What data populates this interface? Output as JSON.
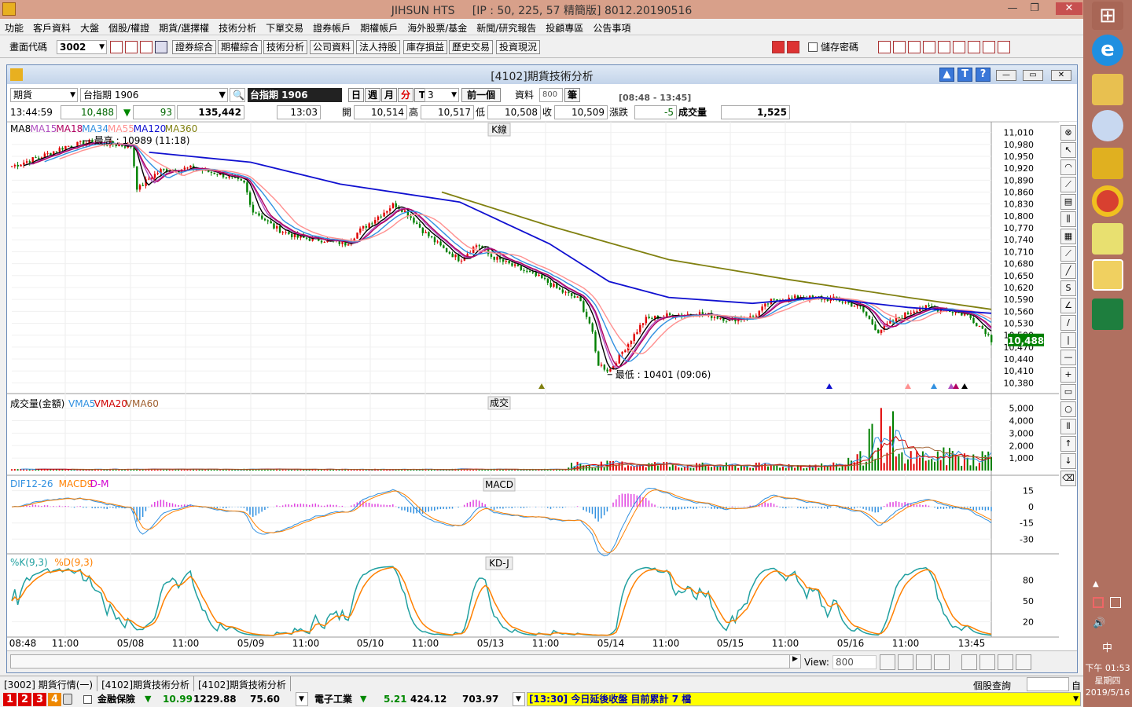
{
  "app": {
    "title": "JIHSUN HTS",
    "conn": "[IP : 50, 225, 57 精簡版] 8012.20190516"
  },
  "menu": [
    "功能",
    "客戶資料",
    "大盤",
    "個股/權證",
    "期貨/選擇權",
    "技術分析",
    "下單交易",
    "證券帳戶",
    "期權帳戶",
    "海外股票/基金",
    "新聞/研究報告",
    "投顧專區",
    "公告事項"
  ],
  "toolbar": {
    "code_label": "畫面代碼",
    "code_value": "3002",
    "buttons": [
      "證券綜合",
      "期權綜合",
      "技術分析",
      "公司資料",
      "法人持股",
      "庫存損益",
      "歷史交易",
      "投資現況"
    ],
    "save_pw": "儲存密碼"
  },
  "window": {
    "title": "[4102]期貨技術分析"
  },
  "query": {
    "type": "期貨",
    "symbol": "台指期 1906",
    "symbol_dark": "台指期 1906",
    "periods": [
      "日",
      "週",
      "月",
      "分",
      "T"
    ],
    "minutes": "3",
    "prev": "前一個",
    "data_label": "資料",
    "data_count": "800",
    "unit": "筆",
    "session": "[08:48 - 13:45]"
  },
  "quote": {
    "time": "13:44:59",
    "price": "10,488",
    "change": "93",
    "total": "135,442",
    "bar_time": "13:03",
    "open_label": "開",
    "open": "10,514",
    "high_label": "高",
    "high": "10,517",
    "low_label": "低",
    "low": "10,508",
    "close_label": "收",
    "close": "10,509",
    "chg_label": "漲跌",
    "chg": "-5",
    "vol_label": "成交量",
    "vol": "1,525"
  },
  "chart_data": [
    {
      "type": "candlestick",
      "panel": "K線",
      "legend": [
        {
          "name": "MA8",
          "color": "#000000"
        },
        {
          "name": "MA15",
          "color": "#b050c0"
        },
        {
          "name": "MA18",
          "color": "#b00060"
        },
        {
          "name": "MA34",
          "color": "#3090e0"
        },
        {
          "name": "MA55",
          "color": "#ff9090"
        },
        {
          "name": "MA120",
          "color": "#1010d0"
        },
        {
          "name": "MA360",
          "color": "#808010"
        }
      ],
      "y_ticks": [
        11010,
        10980,
        10950,
        10920,
        10890,
        10860,
        10830,
        10800,
        10770,
        10740,
        10710,
        10680,
        10650,
        10620,
        10590,
        10560,
        10530,
        10500,
        10470,
        10440,
        10410,
        10380
      ],
      "ylim": [
        10365,
        11025
      ],
      "high_note": "最高 : 10989 (11:18)",
      "low_note": "最低 : 10401 (09:06)",
      "last": "10,488",
      "path_points": [
        [
          0,
          10925
        ],
        [
          5,
          10950
        ],
        [
          9,
          10975
        ],
        [
          13,
          10985
        ],
        [
          17,
          10980
        ],
        [
          20,
          10975
        ],
        [
          21,
          10865
        ],
        [
          23,
          10895
        ],
        [
          25,
          10915
        ],
        [
          30,
          10920
        ],
        [
          35,
          10905
        ],
        [
          39,
          10880
        ],
        [
          40,
          10820
        ],
        [
          44,
          10770
        ],
        [
          48,
          10745
        ],
        [
          52,
          10740
        ],
        [
          56,
          10730
        ],
        [
          58,
          10760
        ],
        [
          61,
          10795
        ],
        [
          64,
          10830
        ],
        [
          66,
          10810
        ],
        [
          69,
          10760
        ],
        [
          72,
          10720
        ],
        [
          75,
          10690
        ],
        [
          78,
          10730
        ],
        [
          80,
          10700
        ],
        [
          83,
          10680
        ],
        [
          86,
          10660
        ],
        [
          89,
          10640
        ],
        [
          92,
          10610
        ],
        [
          95,
          10590
        ],
        [
          97,
          10520
        ],
        [
          98,
          10430
        ],
        [
          100,
          10410
        ],
        [
          103,
          10475
        ],
        [
          106,
          10540
        ],
        [
          110,
          10550
        ],
        [
          115,
          10555
        ],
        [
          120,
          10540
        ],
        [
          124,
          10545
        ],
        [
          127,
          10585
        ],
        [
          132,
          10595
        ],
        [
          138,
          10590
        ],
        [
          142,
          10570
        ],
        [
          145,
          10510
        ],
        [
          148,
          10540
        ],
        [
          152,
          10570
        ],
        [
          156,
          10565
        ],
        [
          160,
          10550
        ],
        [
          163,
          10510
        ],
        [
          164,
          10488
        ]
      ],
      "ma120": [
        [
          23,
          10960
        ],
        [
          40,
          10935
        ],
        [
          55,
          10880
        ],
        [
          75,
          10835
        ],
        [
          90,
          10730
        ],
        [
          100,
          10635
        ],
        [
          110,
          10595
        ],
        [
          124,
          10580
        ],
        [
          135,
          10595
        ],
        [
          150,
          10570
        ],
        [
          164,
          10555
        ]
      ],
      "ma360": [
        [
          72,
          10860
        ],
        [
          90,
          10775
        ],
        [
          110,
          10690
        ],
        [
          130,
          10640
        ],
        [
          150,
          10595
        ],
        [
          164,
          10565
        ]
      ]
    },
    {
      "type": "bar",
      "panel": "成交",
      "legend": [
        {
          "name": "成交量(金額)",
          "color": "#000000"
        },
        {
          "name": "VMA5",
          "color": "#3090e0"
        },
        {
          "name": "VMA20",
          "color": "#d00000"
        },
        {
          "name": "VMA60",
          "color": "#a06030"
        }
      ],
      "y_ticks": [
        5000,
        4000,
        3000,
        2000,
        1000
      ],
      "ylim": [
        0,
        5800
      ]
    },
    {
      "type": "line",
      "panel": "MACD",
      "legend": [
        {
          "name": "DIF12-26",
          "color": "#3090e0"
        },
        {
          "name": "MACD9",
          "color": "#ff8000"
        },
        {
          "name": "D-M",
          "color": "#d000d0"
        }
      ],
      "y_ticks": [
        15,
        0,
        -15,
        -30
      ],
      "ylim": [
        -40,
        22
      ]
    },
    {
      "type": "line",
      "panel": "KD-J",
      "legend": [
        {
          "name": "%K(9,3)",
          "color": "#20a0a0"
        },
        {
          "name": "%D(9,3)",
          "color": "#ff8000"
        }
      ],
      "y_ticks": [
        80,
        50,
        20
      ],
      "ylim": [
        0,
        100
      ]
    }
  ],
  "x_ticks": [
    "08:48",
    "11:00",
    "05/08",
    "11:00",
    "05/09",
    "11:00",
    "05/10",
    "11:00",
    "05/13",
    "11:00",
    "05/14",
    "11:00",
    "05/15",
    "11:00",
    "05/16",
    "11:00",
    "13:45"
  ],
  "bottom": {
    "view_label": "View:",
    "view_value": "800"
  },
  "tabs": [
    "[3002] 期貨行情(一)",
    "[4102]期貨技術分析",
    "[4102]期貨技術分析"
  ],
  "tabs_right": "個股查詢",
  "tabs_right2": "自",
  "status": {
    "nums": [
      "1",
      "2",
      "3",
      "4"
    ],
    "s1_name": "金融保險",
    "s1_chg": "10.99",
    "s1_val": "1229.88",
    "s1_amt": "75.60",
    "s2_name": "電子工業",
    "s2_chg": "5.21",
    "s2_val": "424.12",
    "s2_amt": "703.97",
    "ticker": "[13:30] 今日延後收盤 目前累計 7 檔"
  },
  "taskbar": {
    "time": "下午 01:53",
    "day": "星期四",
    "date": "2019/5/16",
    "ime": "中"
  }
}
